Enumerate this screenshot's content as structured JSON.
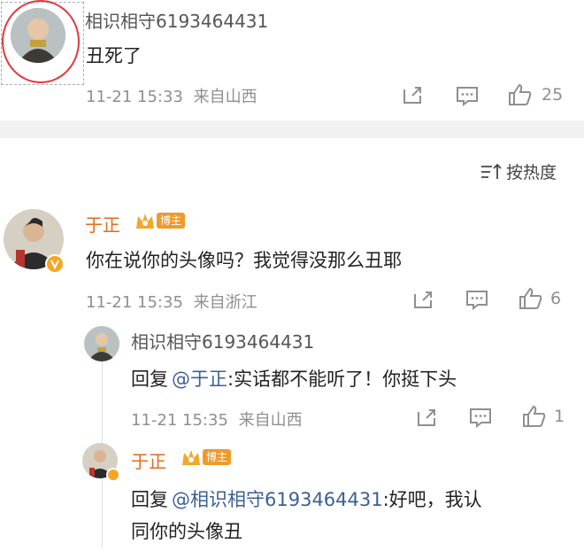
{
  "comment": {
    "author": "相识相守6193464431",
    "text": "丑死了",
    "time": "11-21 15:33",
    "source": "来自山西",
    "likes": "25"
  },
  "sort": {
    "label": "按热度"
  },
  "reply1": {
    "author": "于正",
    "badge": "博主",
    "text": "你在说你的头像吗？我觉得没那么丑耶",
    "time": "11-21 15:35",
    "source": "来自浙江",
    "likes": "6"
  },
  "reply2": {
    "author": "相识相守6193464431",
    "prefix": "回复",
    "mention": "@于正",
    "text": ":实话都不能听了！你挺下头",
    "time": "11-21 15:35",
    "source": "来自山西",
    "likes": "1"
  },
  "reply3": {
    "author": "于正",
    "badge": "博主",
    "prefix": "回复",
    "mention": "@相识相守6193464431",
    "text_line1": ":好吧，我认",
    "text_line2": "同你的头像丑"
  },
  "colors": {
    "accent": "#e8691d",
    "link": "#3a5f96",
    "badge": "#f09a2c",
    "annotation": "#e0393e"
  }
}
